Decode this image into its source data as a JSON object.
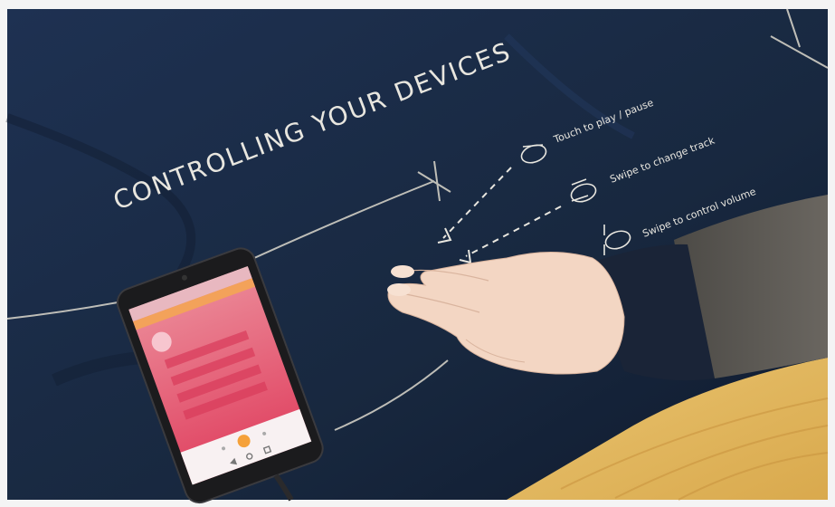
{
  "scene": {
    "headline": "CONTROLLING YOUR DEVICES",
    "gesture_labels": [
      "Touch to play / pause",
      "Swipe to change track",
      "Swipe to control volume"
    ]
  },
  "colors": {
    "fabric": "#1a2b47",
    "fabric_dark": "#101c31",
    "chalk": "#e8e6df",
    "table_wood": "#e3b861",
    "sleeve": "#5a5752",
    "skin": "#f3d8c6",
    "phone_screen": "#e24a6c",
    "phone_accent": "#f5a13a"
  },
  "icons": [
    "touch-gesture-icon",
    "swipe-gesture-icon",
    "volume-gesture-icon",
    "play-icon"
  ]
}
